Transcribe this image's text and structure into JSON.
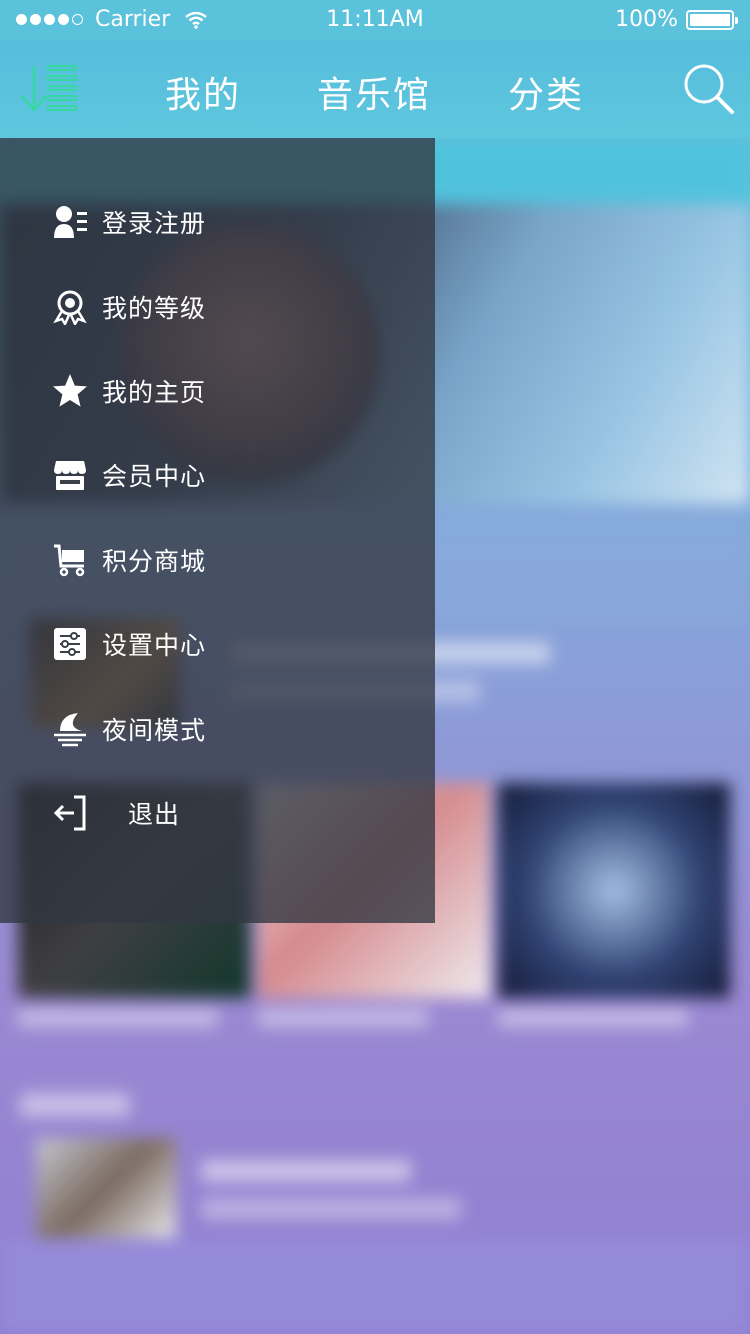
{
  "status_bar": {
    "carrier": "Carrier",
    "time": "11:11AM",
    "battery": "100%"
  },
  "nav": {
    "tabs": [
      "我的",
      "音乐馆",
      "分类"
    ]
  },
  "drawer": {
    "items": [
      {
        "label": "登录注册",
        "icon": "user-login-icon"
      },
      {
        "label": "我的等级",
        "icon": "medal-icon"
      },
      {
        "label": "我的主页",
        "icon": "star-icon"
      },
      {
        "label": "会员中心",
        "icon": "vip-shop-icon"
      },
      {
        "label": "积分商城",
        "icon": "cart-icon"
      },
      {
        "label": "设置中心",
        "icon": "settings-sliders-icon"
      },
      {
        "label": "夜间模式",
        "icon": "moon-icon"
      },
      {
        "label": "退出",
        "icon": "logout-icon"
      }
    ]
  },
  "colors": {
    "accent_green": "#35d9a0",
    "status_bg": "#5ac2db",
    "drawer_bg": "#32374199"
  }
}
